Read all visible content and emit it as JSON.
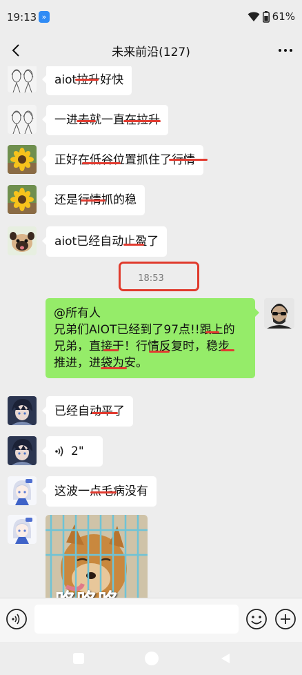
{
  "status": {
    "time": "19:13",
    "app_badge": "»",
    "battery": "61%"
  },
  "header": {
    "title": "未来前沿(127)"
  },
  "messages": [
    {
      "text": "aiot拉升好快",
      "avatar": "sketch-girls-avatar"
    },
    {
      "text": "一进去就一直在拉升",
      "avatar": "sketch-girls-avatar"
    },
    {
      "text": "正好在低谷位置抓住了行情",
      "avatar": "sunflower-avatar"
    },
    {
      "text": "还是行情抓的稳",
      "avatar": "sunflower-avatar"
    },
    {
      "text": "aiot已经自动止盈了",
      "avatar": "pug-avatar"
    },
    {
      "time": "18:53"
    },
    {
      "lines": [
        "@所有人",
        "兄弟们AIOT已经到了97点!!跟上的",
        "兄弟，直接干！行情反复时，稳步",
        "推进，进袋为安。"
      ],
      "avatar": "sunglasses-man-avatar"
    },
    {
      "text": "已经自动平了",
      "avatar": "anime-boy-avatar"
    },
    {
      "voice_duration": "2\"",
      "avatar": "anime-boy-avatar"
    },
    {
      "text": "这波一点毛病没有",
      "avatar": "anime-girl-avatar"
    },
    {
      "image_caption": "咯咯咯",
      "avatar": "anime-girl-avatar",
      "image": "shiba-in-cage-photo"
    }
  ],
  "input": {
    "placeholder": ""
  },
  "colors": {
    "green_bubble": "#95ec69",
    "strike_red": "#e23b30",
    "background": "#ededed"
  }
}
